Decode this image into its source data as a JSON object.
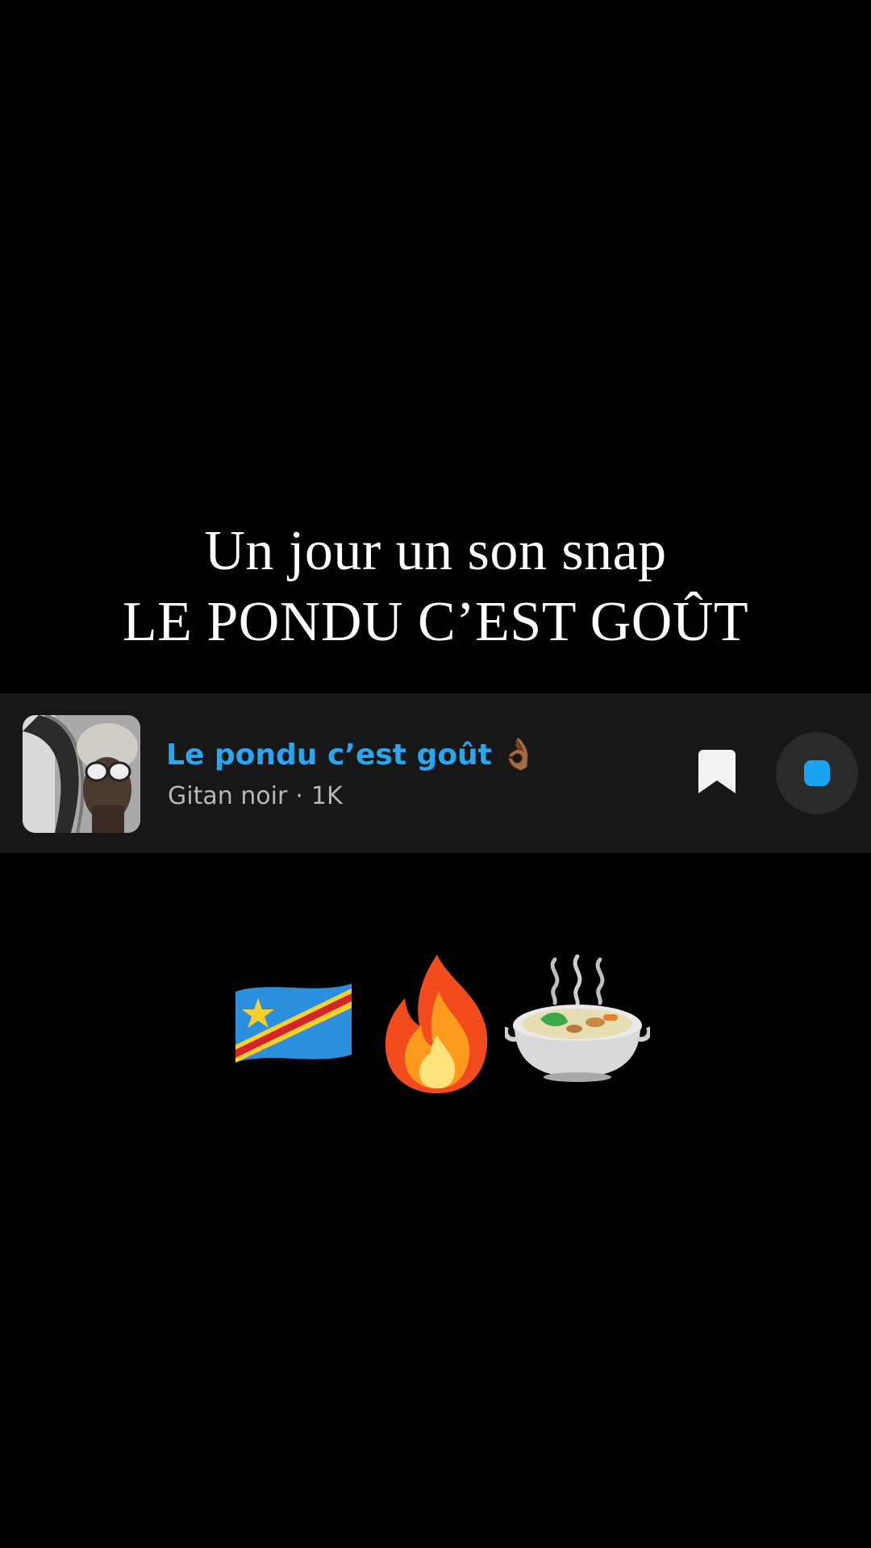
{
  "caption": {
    "line1": "Un jour un son snap",
    "line2": "LE PONDU C’EST GOÛT"
  },
  "music_card": {
    "cover_icon": "album-cover-image",
    "title": "Le pondu c’est goût",
    "title_emoji": "👌🏾",
    "artist": "Gitan noir",
    "separator": "·",
    "plays": "1K",
    "bookmark_icon": "bookmark-icon",
    "play_button_icon": "stop-square-icon",
    "accent_color": "#2aa6ee"
  },
  "emojis": [
    {
      "name": "congo-flag-emoji",
      "glyph": "🇨🇩"
    },
    {
      "name": "fire-emoji",
      "glyph": "🔥"
    },
    {
      "name": "stew-bowl-emoji",
      "glyph": "🍲"
    }
  ]
}
